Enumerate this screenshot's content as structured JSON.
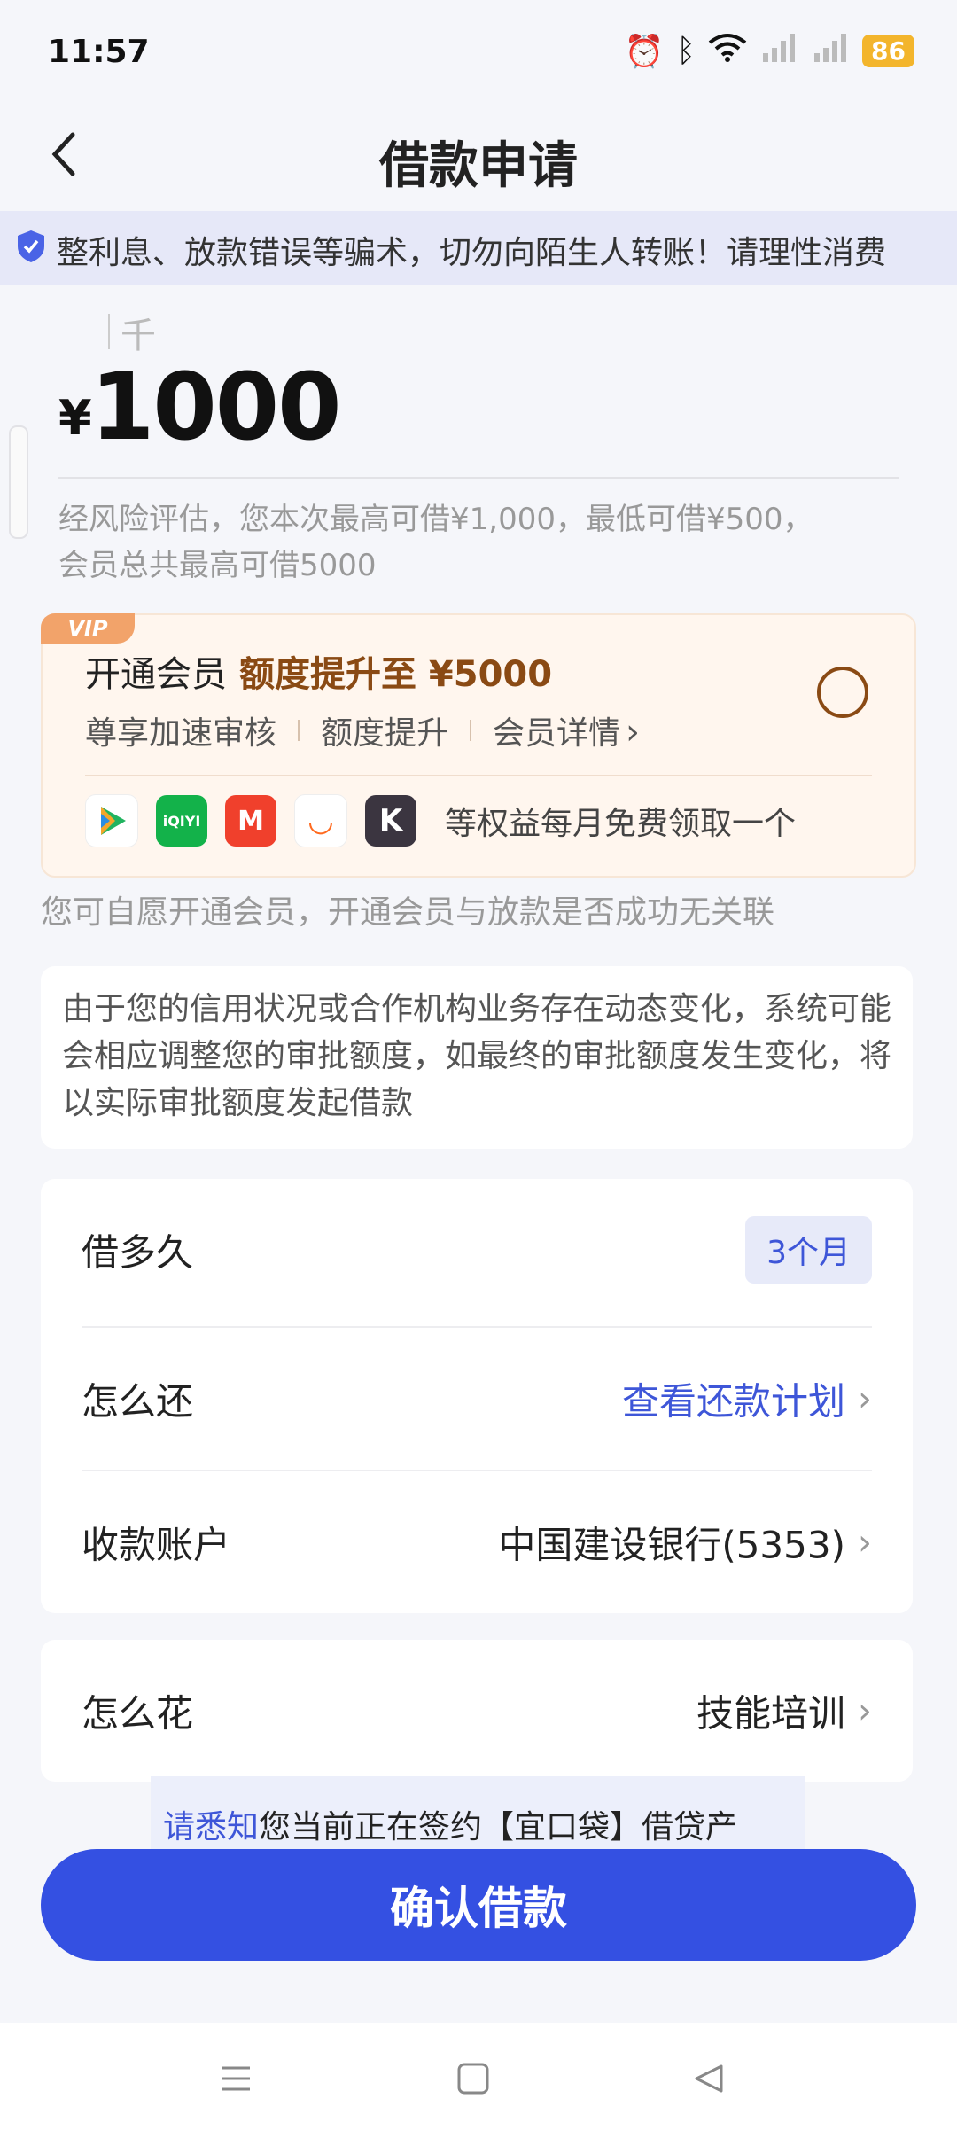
{
  "status_bar": {
    "time": "11:57",
    "battery": "86"
  },
  "nav": {
    "title": "借款申请"
  },
  "notice": {
    "text": "整利息、放款错误等骗术，切勿向陌生人转账！请理性消费"
  },
  "amount": {
    "unit_hint": "千",
    "currency": "¥",
    "value": "1000",
    "description": "经风险评估，您本次最高可借¥1,000，最低可借¥500，会员总共最高可借5000"
  },
  "vip": {
    "badge": "VIP",
    "title": "开通会员",
    "highlight": "额度提升至 ¥5000",
    "benefits": [
      "尊享加速审核",
      "额度提升",
      "会员详情"
    ],
    "apps": [
      {
        "label": "▶",
        "color": "#2bb673"
      },
      {
        "label": "iQIYI",
        "color": "#18b24b"
      },
      {
        "label": "M",
        "color": "#f0402c"
      },
      {
        "label": "◡",
        "color": "#ff6a1f"
      },
      {
        "label": "K",
        "color": "#3b3540"
      }
    ],
    "apps_desc": "等权益每月免费领取一个",
    "note": "您可自愿开通会员，开通会员与放款是否成功无关联"
  },
  "info": {
    "text": "由于您的信用状况或合作机构业务存在动态变化，系统可能会相应调整您的审批额度，如最终的审批额度发生变化，将以实际审批额度发起借款"
  },
  "form": {
    "term_label": "借多久",
    "term_value": "3个月",
    "repay_label": "怎么还",
    "repay_value": "查看还款计划",
    "account_label": "收款账户",
    "account_value": "中国建设银行(5353)",
    "use_label": "怎么花",
    "use_value": "技能培训"
  },
  "consent": {
    "link": "请悉知",
    "text": "您当前正在签约【宜口袋】借贷产"
  },
  "confirm": {
    "label": "确认借款"
  },
  "colors": {
    "primary": "#3450e2",
    "vip_accent": "#8a4a14"
  }
}
